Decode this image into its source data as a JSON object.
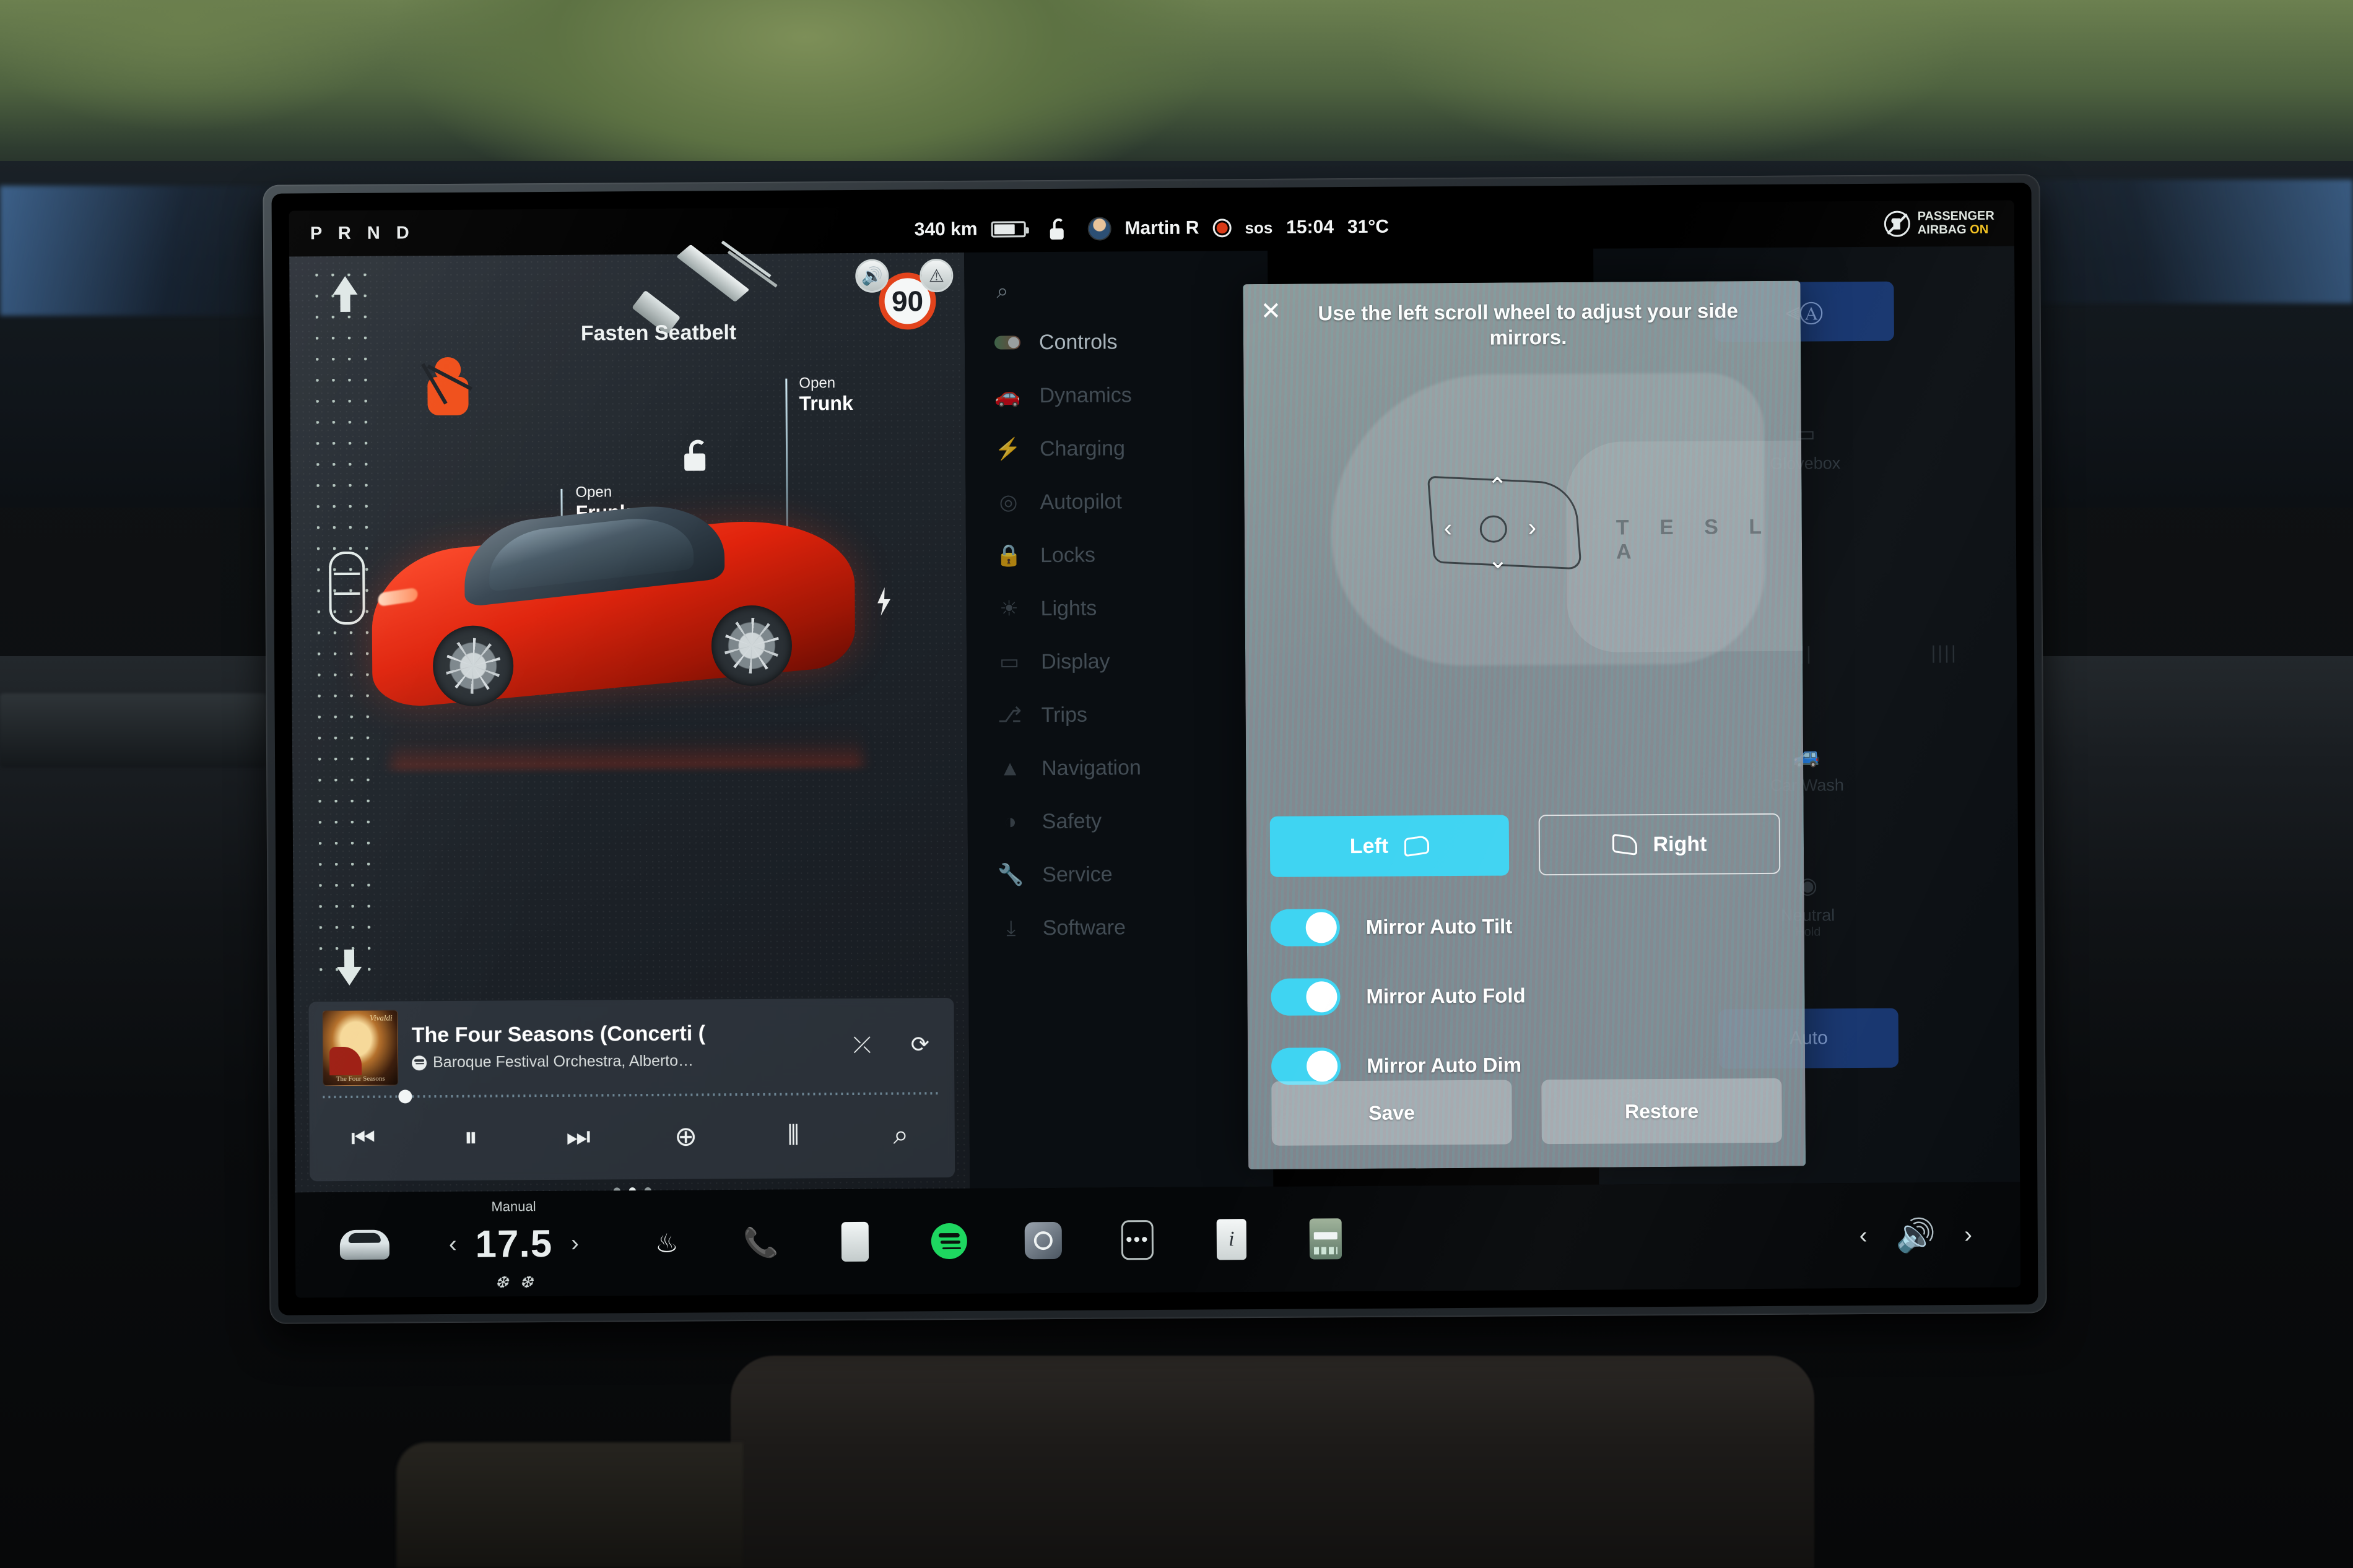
{
  "status_bar": {
    "gear_selector": "P R N D",
    "range": "340 km",
    "battery_icon": "battery-icon",
    "lock_icon": "unlock-icon",
    "driver_profile": "Martin R",
    "record_icon": "record-dot-icon",
    "sos_label": "sos",
    "time": "15:04",
    "outside_temp": "31°C",
    "airbag_line1": "PASSENGER",
    "airbag_line2": "AIRBAG",
    "airbag_state": "ON",
    "airbag_state_color": "#f2c11c"
  },
  "car_panel": {
    "alerts": {
      "seatbelt": "Fasten Seatbelt"
    },
    "speed_limit": "90",
    "callouts": [
      {
        "small": "Open",
        "large": "Frunk"
      },
      {
        "small": "Open",
        "large": "Trunk"
      }
    ],
    "icons": {
      "seatbelt_person": "seatbelt-person-icon",
      "seatbelt_buckle": "seatbelt-buckle-icon",
      "unlock": "unlock-icon",
      "charge_port": "charge-bolt-icon",
      "speaker_badge": "speaker-icon",
      "warning_badge": "warning-triangle-icon"
    }
  },
  "media": {
    "track_title": "The Four Seasons (Concerti (",
    "artist": "Baroque Festival Orchestra, Alberto…",
    "source_icon": "spotify-icon",
    "shuffle_icon": "shuffle-icon",
    "repeat_icon": "repeat-icon",
    "controls": [
      {
        "name": "previous-track-button",
        "glyph": "⏮"
      },
      {
        "name": "pause-button",
        "glyph": "⏸"
      },
      {
        "name": "next-track-button",
        "glyph": "⏭"
      },
      {
        "name": "add-to-library-button",
        "glyph": "⊕"
      },
      {
        "name": "equalizer-button",
        "glyph": "⦀"
      },
      {
        "name": "search-media-button",
        "glyph": "⌕"
      }
    ],
    "page_dots": 3,
    "active_dot": 1
  },
  "controls_sidebar": {
    "search_icon": "search-icon",
    "items": [
      {
        "label": "Controls",
        "icon": "toggle-pill-icon",
        "active": true
      },
      {
        "label": "Dynamics",
        "icon": "car-dynamics-icon",
        "active": false
      },
      {
        "label": "Charging",
        "icon": "charge-bolt-icon",
        "active": false
      },
      {
        "label": "Autopilot",
        "icon": "steering-wheel-icon",
        "active": false
      },
      {
        "label": "Locks",
        "icon": "lock-icon",
        "active": false
      },
      {
        "label": "Lights",
        "icon": "headlight-icon",
        "active": false
      },
      {
        "label": "Display",
        "icon": "display-icon",
        "active": false
      },
      {
        "label": "Trips",
        "icon": "trips-icon",
        "active": false
      },
      {
        "label": "Navigation",
        "icon": "navigation-arrow-icon",
        "active": false
      },
      {
        "label": "Safety",
        "icon": "safety-shield-icon",
        "active": false
      },
      {
        "label": "Service",
        "icon": "wrench-icon",
        "active": false
      },
      {
        "label": "Software",
        "icon": "download-icon",
        "active": false
      }
    ]
  },
  "right_column": {
    "auto_headlights_icon": "auto-headlight-icon",
    "glovebox_label": "Glovebox",
    "car_wash_label": "Car Wash",
    "neutral_label": "Neutral",
    "neutral_sub": "Hold",
    "auto_label": "Auto",
    "brightness_icon": "brightness-icon"
  },
  "mirror_dialog": {
    "close_icon": "close-icon",
    "title": "Use the left scroll wheel to adjust your side mirrors.",
    "brand_mark": "T E S L A",
    "side_buttons": [
      {
        "label": "Left",
        "selected": true,
        "icon": "mirror-left-icon"
      },
      {
        "label": "Right",
        "selected": false,
        "icon": "mirror-right-icon"
      }
    ],
    "toggles": [
      {
        "label": "Mirror Auto Tilt",
        "on": true
      },
      {
        "label": "Mirror Auto Fold",
        "on": true
      },
      {
        "label": "Mirror Auto Dim",
        "on": true
      }
    ],
    "actions": [
      {
        "label": "Save"
      },
      {
        "label": "Restore"
      }
    ],
    "accent_color": "#3fd4f2",
    "dpad": {
      "up": "⌃",
      "down": "⌄",
      "left": "‹",
      "right": "›"
    }
  },
  "app_bar": {
    "car_icon": "car-front-icon",
    "climate_mode": "Manual",
    "temperature": "17.5",
    "temp_down": "‹",
    "temp_up": "›",
    "defrost_front_icon": "defrost-front-icon",
    "defrost_rear_icon": "defrost-rear-icon",
    "seat_heater_icon": "seat-heater-icon",
    "phone_icon": "phone-icon",
    "calendar_icon": "calendar-icon",
    "spotify_icon": "spotify-icon",
    "camera_icon": "camera-icon",
    "more_icon": "more-apps-icon",
    "notes_icon": "info-app-icon",
    "calculator_icon": "calculator-app-icon",
    "volume_down": "‹",
    "volume_icon": "volume-icon",
    "volume_up": "›"
  }
}
